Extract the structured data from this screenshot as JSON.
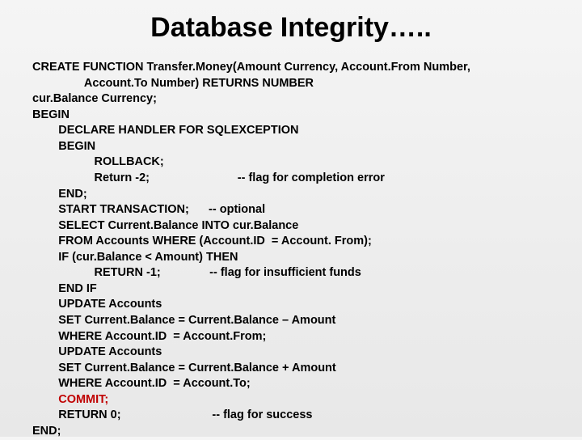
{
  "title": "Database Integrity…..",
  "code": {
    "l1": "CREATE FUNCTION Transfer.Money(Amount Currency, Account.From Number,",
    "l2": "                Account.To Number) RETURNS NUMBER",
    "l3": "cur.Balance Currency;",
    "l4": "BEGIN",
    "l5": "        DECLARE HANDLER FOR SQLEXCEPTION",
    "l6": "        BEGIN",
    "l7": "                   ROLLBACK;",
    "l8a": "                   Return -2;",
    "l8b": "-- flag for completion error",
    "l9": "        END;",
    "l10a": "        START TRANSACTION;",
    "l10b": "-- optional",
    "l11": "        SELECT Current.Balance INTO cur.Balance",
    "l12": "        FROM Accounts WHERE (Account.ID  = Account. From);",
    "l13": "        IF (cur.Balance < Amount) THEN",
    "l14a": "                   RETURN -1;",
    "l14b": "-- flag for insufficient funds",
    "l15": "        END IF",
    "l16": "        UPDATE Accounts",
    "l17": "        SET Current.Balance = Current.Balance – Amount",
    "l18": "        WHERE Account.ID  = Account.From;",
    "l19": "        UPDATE Accounts",
    "l20": "        SET Current.Balance = Current.Balance + Amount",
    "l21": "        WHERE Account.ID  = Account.To;",
    "l22": "        COMMIT;",
    "l23a": "        RETURN 0;",
    "l23b": "-- flag for success",
    "l24": "END;"
  }
}
